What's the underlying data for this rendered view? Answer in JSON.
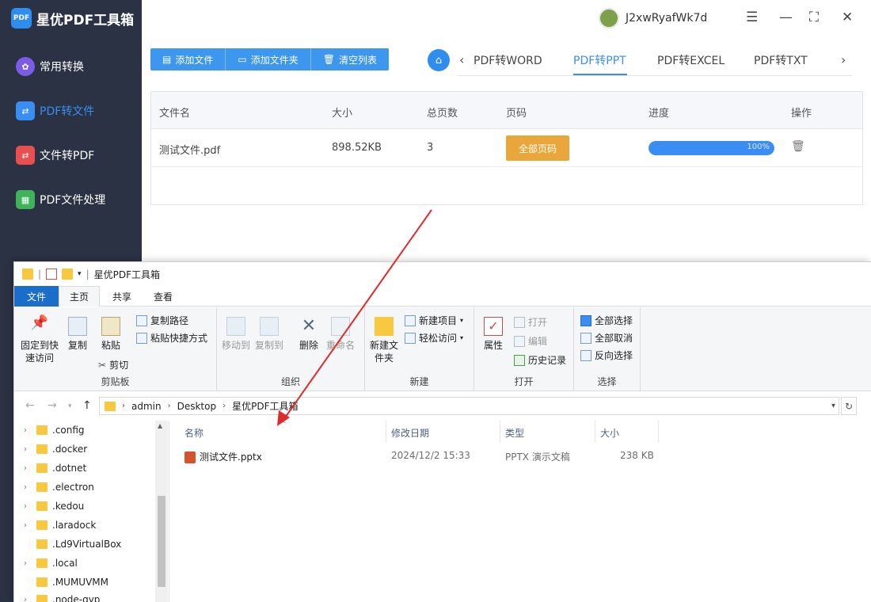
{
  "app": {
    "logo_badge": "PDF",
    "title": "星优PDF工具箱",
    "user": "J2xwRyafWk7d"
  },
  "sidebar": {
    "items": [
      {
        "label": "常用转换",
        "icon": "grid-icon",
        "color": "#7a5ce6"
      },
      {
        "label": "PDF转文件",
        "icon": "pdf-convert-icon",
        "color": "#3a8df2",
        "active": true
      },
      {
        "label": "文件转PDF",
        "icon": "file-to-pdf-icon",
        "color": "#e8504f"
      },
      {
        "label": "PDF文件处理",
        "icon": "pdf-process-icon",
        "color": "#3fb35a"
      }
    ]
  },
  "toolbar": {
    "add_file": "添加文件",
    "add_folder": "添加文件夹",
    "clear_list": "清空列表"
  },
  "tabs": [
    "PDF转WORD",
    "PDF转PPT",
    "PDF转EXCEL",
    "PDF转TXT"
  ],
  "active_tab": "PDF转PPT",
  "table": {
    "headers": {
      "name": "文件名",
      "size": "大小",
      "pages": "总页数",
      "page_range": "页码",
      "progress": "进度",
      "action": "操作"
    },
    "rows": [
      {
        "name": "测试文件.pdf",
        "size": "898.52KB",
        "pages": "3",
        "page_button": "全部页码",
        "progress_text": "100%",
        "progress_value": 100
      }
    ]
  },
  "explorer": {
    "title": "星优PDF工具箱",
    "ribbon_tabs": [
      "文件",
      "主页",
      "共享",
      "查看"
    ],
    "ribbon": {
      "pin": "固定到快速访问",
      "copy": "复制",
      "paste": "粘贴",
      "copy_path": "复制路径",
      "paste_shortcut": "粘贴快捷方式",
      "cut": "剪切",
      "clipboard": "剪贴板",
      "move_to": "移动到",
      "copy_to": "复制到",
      "delete": "删除",
      "rename": "重命名",
      "organize": "组织",
      "new_folder": "新建文件夹",
      "new_item": "新建项目",
      "easy_access": "轻松访问",
      "new": "新建",
      "properties": "属性",
      "open": "打开",
      "edit": "编辑",
      "history": "历史记录",
      "open_group": "打开",
      "select_all": "全部选择",
      "select_none": "全部取消",
      "invert_select": "反向选择",
      "select_group": "选择"
    },
    "breadcrumb": [
      "admin",
      "Desktop",
      "星优PDF工具箱"
    ],
    "tree": [
      ".config",
      ".docker",
      ".dotnet",
      ".electron",
      ".kedou",
      ".laradock",
      ".Ld9VirtualBox",
      ".local",
      ".MUMUVMM",
      ".node-gyp"
    ],
    "columns": {
      "name": "名称",
      "modified": "修改日期",
      "type": "类型",
      "size": "大小"
    },
    "files": [
      {
        "name": "测试文件.pptx",
        "modified": "2024/12/2 15:33",
        "type": "PPTX 演示文稿",
        "size": "238 KB"
      }
    ]
  },
  "annotation_color": "#e02b2b"
}
